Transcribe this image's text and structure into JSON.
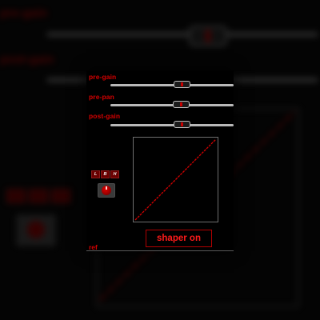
{
  "plugin": {
    "sliders": [
      {
        "id": "pre-gain",
        "label": "pre-gain",
        "value": 0.58
      },
      {
        "id": "pre-pan",
        "label": "pre-pan",
        "value": 0.57
      },
      {
        "id": "post-gain",
        "label": "post-gain",
        "value": 0.58
      }
    ],
    "band_buttons": [
      {
        "id": "low",
        "label": "L"
      },
      {
        "id": "band",
        "label": "B"
      },
      {
        "id": "high",
        "label": "H"
      }
    ],
    "shaper_button_label": "shaper on",
    "corner_label": "ref",
    "transfer_curve": [
      [
        0,
        0
      ],
      [
        1,
        1
      ]
    ]
  },
  "background_echo": {
    "labels": [
      "pre-gain",
      "post-gain"
    ]
  },
  "colors": {
    "accent_red": "#d40000",
    "panel_bg": "#000000",
    "slider_track": "#b8b8b8",
    "graph_border": "#6e6e6e"
  },
  "icons": {
    "knob": "rotary-knob-icon",
    "thumb_mark": "thumb-indicator-icon"
  }
}
